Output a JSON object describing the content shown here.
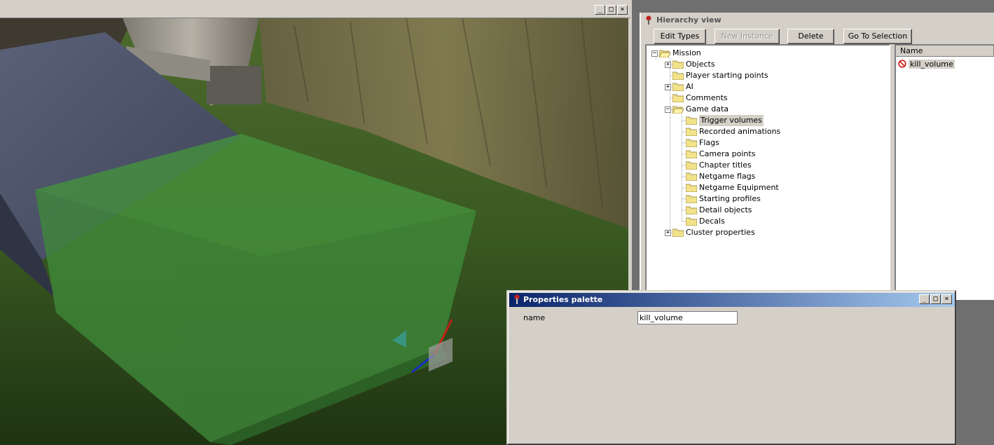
{
  "viewport": {
    "controls": {
      "minimize": "_",
      "maximize": "□",
      "close": "×"
    }
  },
  "hierarchy": {
    "title": "Hierarchy view",
    "toolbar": {
      "edit_types": "Edit Types",
      "new_instance": "New Instance",
      "delete": "Delete",
      "go_to_selection": "Go To Selection"
    },
    "tree": {
      "root": "Mission",
      "items": [
        {
          "label": "Objects",
          "level": 1,
          "expander": "+"
        },
        {
          "label": "Player starting points",
          "level": 1,
          "expander": ""
        },
        {
          "label": "AI",
          "level": 1,
          "expander": "+"
        },
        {
          "label": "Comments",
          "level": 1,
          "expander": ""
        },
        {
          "label": "Game data",
          "level": 1,
          "expander": "−"
        },
        {
          "label": "Trigger volumes",
          "level": 2,
          "selected": true
        },
        {
          "label": "Recorded animations",
          "level": 2
        },
        {
          "label": "Flags",
          "level": 2
        },
        {
          "label": "Camera points",
          "level": 2
        },
        {
          "label": "Chapter titles",
          "level": 2
        },
        {
          "label": "Netgame flags",
          "level": 2
        },
        {
          "label": "Netgame Equipment",
          "level": 2
        },
        {
          "label": "Starting profiles",
          "level": 2
        },
        {
          "label": "Detail objects",
          "level": 2
        },
        {
          "label": "Decals",
          "level": 2
        },
        {
          "label": "Cluster properties",
          "level": 1,
          "expander": "+"
        }
      ]
    },
    "list": {
      "column_header": "Name",
      "items": [
        "kill_volume"
      ]
    }
  },
  "properties": {
    "title": "Properties palette",
    "fields": [
      {
        "label": "name",
        "value": "kill_volume"
      }
    ],
    "controls": {
      "minimize": "_",
      "maximize": "□",
      "close": "×"
    }
  },
  "colors": {
    "trigger_volume": "#3f8a3a",
    "titlebar_active_start": "#0a246a",
    "titlebar_active_end": "#a6caf0",
    "window_face": "#d4d0c8"
  }
}
